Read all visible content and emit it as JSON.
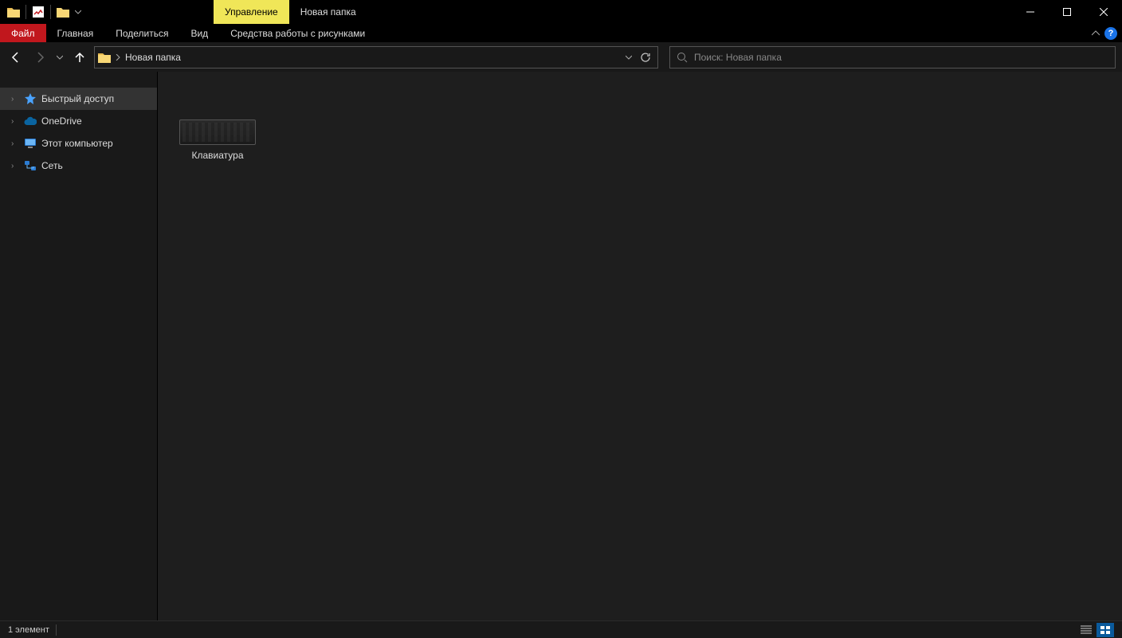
{
  "window": {
    "title": "Новая папка",
    "context_tab": "Управление"
  },
  "ribbon": {
    "file": "Файл",
    "tabs": [
      "Главная",
      "Поделиться",
      "Вид"
    ],
    "context_tabs": [
      "Средства работы с рисунками"
    ]
  },
  "nav": {
    "breadcrumb": "Новая папка"
  },
  "search": {
    "placeholder": "Поиск: Новая папка"
  },
  "sidebar": {
    "items": [
      {
        "label": "Быстрый доступ",
        "icon": "star",
        "selected": true
      },
      {
        "label": "OneDrive",
        "icon": "cloud",
        "selected": false
      },
      {
        "label": "Этот компьютер",
        "icon": "pc",
        "selected": false
      },
      {
        "label": "Сеть",
        "icon": "network",
        "selected": false
      }
    ]
  },
  "files": [
    {
      "name": "Клавиатура"
    }
  ],
  "status": {
    "count_text": "1 элемент"
  }
}
